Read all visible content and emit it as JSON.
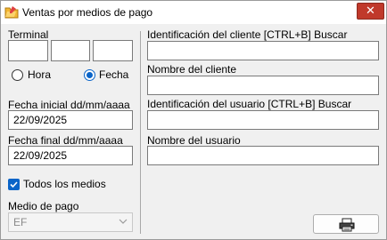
{
  "window": {
    "title": "Ventas por medios de pago",
    "close_glyph": "✕",
    "icon": "folder-app-icon"
  },
  "left": {
    "terminal_label": "Terminal",
    "terminal_fields": [
      "",
      "",
      ""
    ],
    "radio_hora_label": "Hora",
    "radio_fecha_label": "Fecha",
    "radio_selected": "Fecha",
    "fecha_inicial_label": "Fecha inicial dd/mm/aaaa",
    "fecha_inicial_value": "22/09/2025",
    "fecha_final_label": "Fecha final dd/mm/aaaa",
    "fecha_final_value": "22/09/2025",
    "todos_medios_label": "Todos los medios",
    "todos_medios_checked": true,
    "medio_pago_label": "Medio de pago",
    "medio_pago_value": "EF"
  },
  "right": {
    "id_cliente_label": "Identificación del cliente [CTRL+B] Buscar",
    "id_cliente_value": "",
    "nombre_cliente_label": "Nombre del cliente",
    "nombre_cliente_value": "",
    "id_usuario_label": "Identificación del usuario [CTRL+B] Buscar",
    "id_usuario_value": "",
    "nombre_usuario_label": "Nombre del usuario",
    "nombre_usuario_value": ""
  },
  "toolbar": {
    "print_icon": "printer-icon"
  },
  "colors": {
    "accent": "#0a64c8",
    "close": "#c0392b"
  }
}
